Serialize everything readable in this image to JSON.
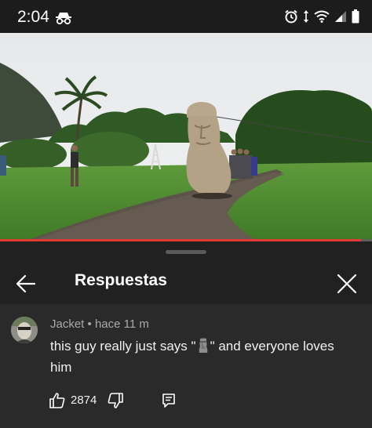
{
  "status_bar": {
    "time": "2:04",
    "icons": [
      "incognito-icon",
      "alarm-icon",
      "data-arrows-icon",
      "wifi-icon",
      "signal-icon",
      "battery-icon"
    ]
  },
  "video": {
    "description_icon": "video-thumbnail",
    "progress_fraction": 0.97,
    "progress_color": "#e53935"
  },
  "panel": {
    "title": "Respuestas",
    "back_icon": "back-arrow-icon",
    "close_icon": "close-icon"
  },
  "reply": {
    "author": "Jacket",
    "separator": "•",
    "time_ago": "hace 11 m",
    "text_before": "this guy really just says \"",
    "emoji": "moai-emoji",
    "text_after": "\" and everyone loves him",
    "like_count": "2874",
    "like_icon": "thumbs-up-icon",
    "dislike_icon": "thumbs-down-icon",
    "reply_icon": "reply-icon"
  },
  "colors": {
    "background": "#212121",
    "reply_background": "#2a2a2a",
    "meta_text": "#aaaaaa"
  }
}
